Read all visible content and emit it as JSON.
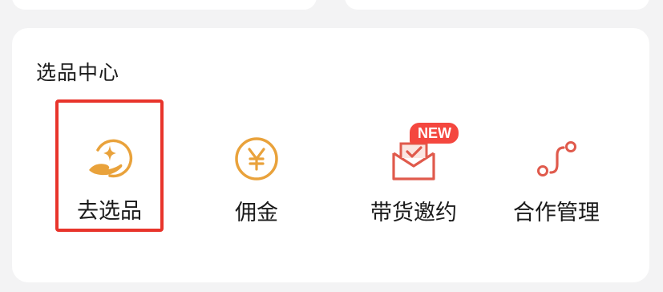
{
  "section": {
    "title": "选品中心"
  },
  "entries": [
    {
      "label": "去选品",
      "icon": "hand-star-icon",
      "color": "#e9a23b",
      "selected": true
    },
    {
      "label": "佣金",
      "icon": "yen-circle-icon",
      "color": "#e9a23b"
    },
    {
      "label": "带货邀约",
      "icon": "envelope-check-icon",
      "color": "#e05a4c",
      "badge": "NEW"
    },
    {
      "label": "合作管理",
      "icon": "connection-path-icon",
      "color": "#e05a4c"
    }
  ],
  "colors": {
    "highlight_border": "#e8342b",
    "badge_bg": "#f4473f",
    "orange": "#e9a23b",
    "red": "#e05a4c"
  }
}
